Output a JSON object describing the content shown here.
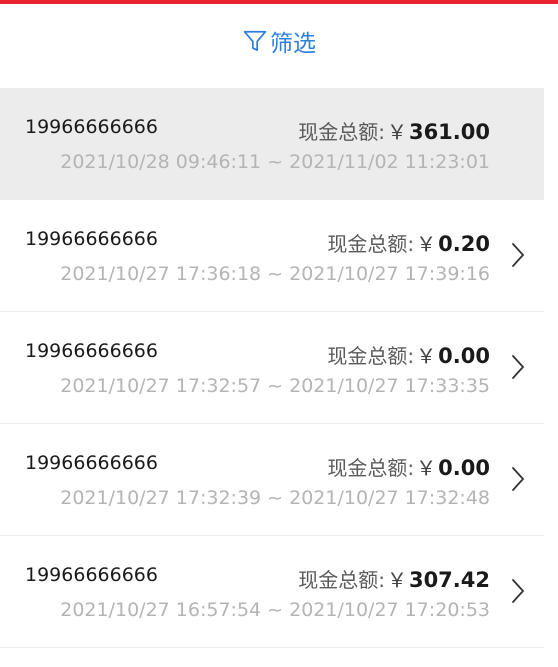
{
  "filter": {
    "icon": "funnel-icon",
    "label": "筛选",
    "color": "#2f7fe0"
  },
  "accent_bar_color": "#e8232e",
  "records": [
    {
      "phone": "19966666666",
      "amount_label": "现金总额:",
      "currency": "￥",
      "amount": "361.00",
      "period": "2021/10/28 09:46:11 ~ 2021/11/02 11:23:01",
      "selected": true,
      "has_chevron": false
    },
    {
      "phone": "19966666666",
      "amount_label": "现金总额:",
      "currency": "￥",
      "amount": "0.20",
      "period": "2021/10/27 17:36:18 ~ 2021/10/27 17:39:16",
      "selected": false,
      "has_chevron": true
    },
    {
      "phone": "19966666666",
      "amount_label": "现金总额:",
      "currency": "￥",
      "amount": "0.00",
      "period": "2021/10/27 17:32:57 ~ 2021/10/27 17:33:35",
      "selected": false,
      "has_chevron": true
    },
    {
      "phone": "19966666666",
      "amount_label": "现金总额:",
      "currency": "￥",
      "amount": "0.00",
      "period": "2021/10/27 17:32:39 ~ 2021/10/27 17:32:48",
      "selected": false,
      "has_chevron": true
    },
    {
      "phone": "19966666666",
      "amount_label": "现金总额:",
      "currency": "￥",
      "amount": "307.42",
      "period": "2021/10/27 16:57:54 ~ 2021/10/27 17:20:53",
      "selected": false,
      "has_chevron": true
    }
  ]
}
